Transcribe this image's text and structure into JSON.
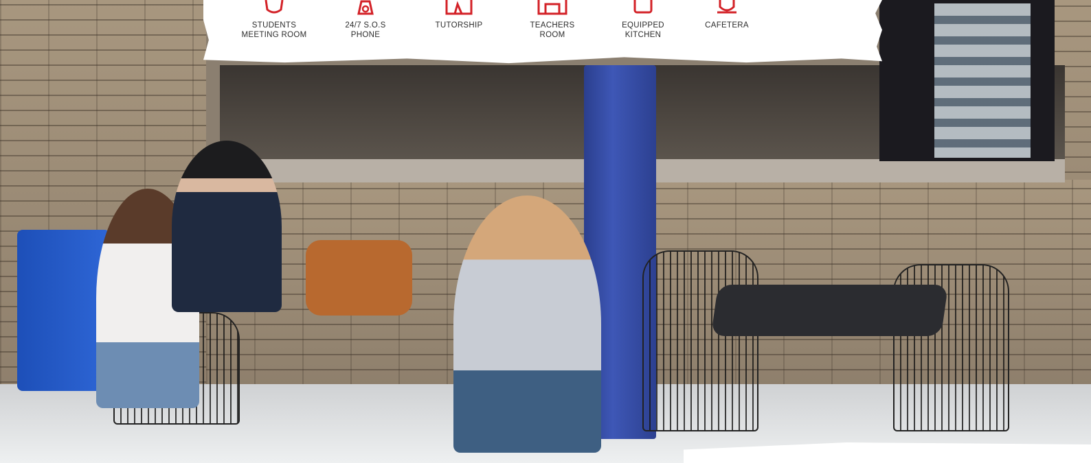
{
  "amenities": [
    {
      "label": "STUDENTS\nMEETING ROOM",
      "icon": "meeting-room-icon"
    },
    {
      "label": "24/7 S.O.S\nPHONE",
      "icon": "phone-icon"
    },
    {
      "label": "TUTORSHIP",
      "icon": "tutorship-icon"
    },
    {
      "label": "TEACHERS\nROOM",
      "icon": "teachers-room-icon"
    },
    {
      "label": "EQUIPPED\nKITCHEN",
      "icon": "kitchen-icon"
    },
    {
      "label": "CAFETERA",
      "icon": "coffee-cup-icon"
    }
  ],
  "colors": {
    "accent": "#d32127",
    "banner": "#ffffff"
  }
}
